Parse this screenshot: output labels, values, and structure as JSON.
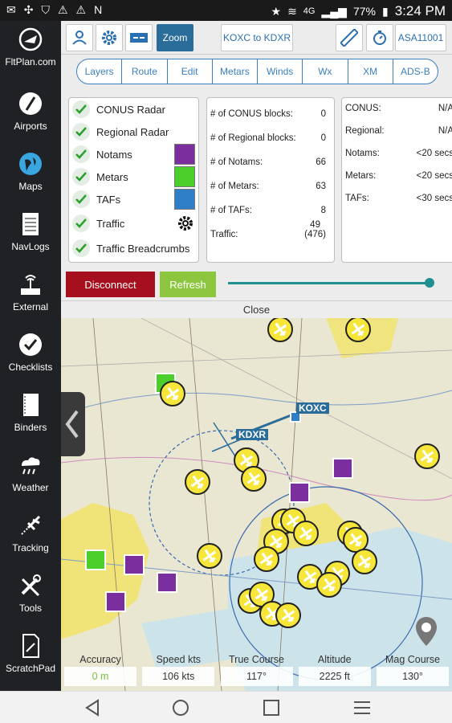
{
  "status_bar": {
    "battery": "77%",
    "time": "3:24 PM",
    "network": "4G"
  },
  "sidebar": {
    "items": [
      {
        "label": "FltPlan.com",
        "icon": "fltplan-logo-icon"
      },
      {
        "label": "Airports",
        "icon": "airports-icon"
      },
      {
        "label": "Maps",
        "icon": "maps-globe-icon"
      },
      {
        "label": "NavLogs",
        "icon": "navlogs-icon"
      },
      {
        "label": "External",
        "icon": "external-icon"
      },
      {
        "label": "Checklists",
        "icon": "checklists-icon"
      },
      {
        "label": "Binders",
        "icon": "binders-icon"
      },
      {
        "label": "Weather",
        "icon": "weather-icon"
      },
      {
        "label": "Tracking",
        "icon": "tracking-icon"
      },
      {
        "label": "Tools",
        "icon": "tools-icon"
      },
      {
        "label": "ScratchPad",
        "icon": "scratchpad-icon"
      }
    ]
  },
  "toolbar": {
    "zoom_label": "Zoom",
    "route_label": "KOXC to KDXR",
    "aircraft_label": "ASA11001"
  },
  "tabs": [
    "Layers",
    "Route",
    "Edit",
    "Metars",
    "Winds",
    "Wx",
    "XM",
    "ADS-B"
  ],
  "layers": {
    "items": [
      {
        "label": "CONUS Radar",
        "checked": true
      },
      {
        "label": "Regional Radar",
        "checked": true
      },
      {
        "label": "Notams",
        "checked": true,
        "color": "#7b2f9e"
      },
      {
        "label": "Metars",
        "checked": true,
        "color": "#4ccf2a"
      },
      {
        "label": "TAFs",
        "checked": true,
        "color": "#2f7fc8"
      },
      {
        "label": "Traffic",
        "checked": true
      },
      {
        "label": "Traffic Breadcrumbs",
        "checked": true
      }
    ]
  },
  "counts": {
    "rows": [
      {
        "label": "# of CONUS blocks:",
        "value": "0"
      },
      {
        "label": "# of Regional blocks:",
        "value": "0"
      },
      {
        "label": "# of Notams:",
        "value": "66"
      },
      {
        "label": "# of Metars:",
        "value": "63"
      },
      {
        "label": "# of TAFs:",
        "value": "8"
      },
      {
        "label": "Traffic:",
        "value": "49",
        "value2": "(476)"
      }
    ]
  },
  "ages": {
    "rows": [
      {
        "label": "CONUS:",
        "value": "N/A"
      },
      {
        "label": "Regional:",
        "value": "N/A"
      },
      {
        "label": "Notams:",
        "value": "<20 secs"
      },
      {
        "label": "Metars:",
        "value": "<20 secs"
      },
      {
        "label": "TAFs:",
        "value": "<30 secs"
      }
    ]
  },
  "actions": {
    "disconnect": "Disconnect",
    "refresh": "Refresh",
    "close": "Close"
  },
  "slider": {
    "level": 1.0
  },
  "map": {
    "airports": {
      "origin": "KOXC",
      "destination": "KDXR"
    }
  },
  "instruments": [
    {
      "label": "Accuracy",
      "value": "0 m",
      "color": "#7ac143"
    },
    {
      "label": "Speed kts",
      "value": "106 kts"
    },
    {
      "label": "True Course",
      "value": "117°"
    },
    {
      "label": "Altitude",
      "value": "2225 ft"
    },
    {
      "label": "Mag Course",
      "value": "130°"
    }
  ]
}
